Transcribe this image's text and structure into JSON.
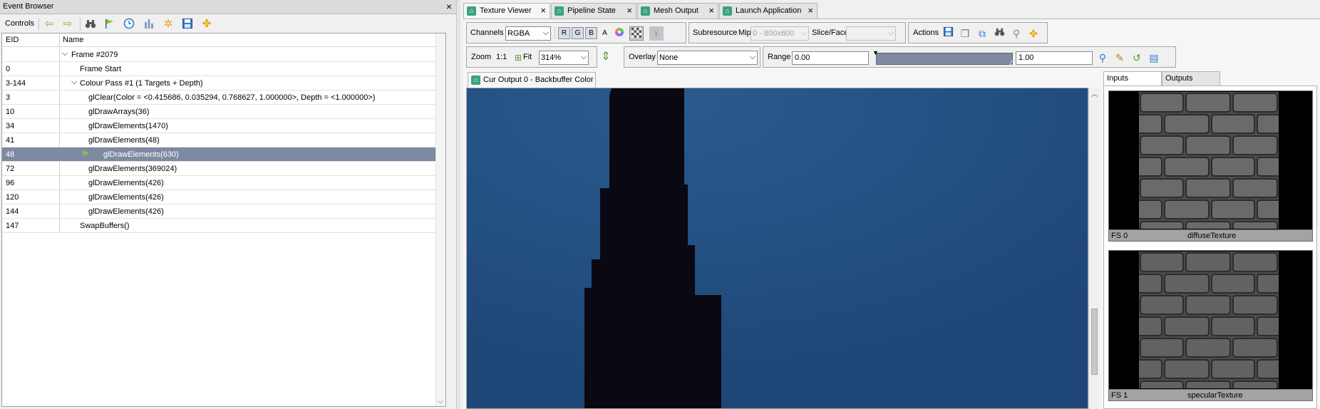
{
  "event_browser": {
    "title": "Event Browser",
    "close": "×",
    "toolbar": {
      "label": "Controls",
      "icons": [
        "arrow-left-icon",
        "arrow-right-icon",
        "binoculars-icon",
        "flag-icon",
        "clock-icon",
        "bar-chart-icon",
        "gear-icon",
        "save-icon",
        "puzzle-icon"
      ]
    },
    "columns": {
      "eid": "EID",
      "name": "Name"
    },
    "rows": [
      {
        "eid": "",
        "name": "Frame #2079",
        "expanded": true
      },
      {
        "eid": "0",
        "name": "Frame Start"
      },
      {
        "eid": "3-144",
        "name": "Colour Pass #1 (1 Targets + Depth)",
        "expanded": true
      },
      {
        "eid": "3",
        "name": "glClear(Color = <0.415686, 0.035294, 0.768627, 1.000000>, Depth = <1.000000>)"
      },
      {
        "eid": "10",
        "name": "glDrawArrays(36)"
      },
      {
        "eid": "34",
        "name": "glDrawElements(1470)"
      },
      {
        "eid": "41",
        "name": "glDrawElements(48)"
      },
      {
        "eid": "48",
        "name": "glDrawElements(630)",
        "selected": true
      },
      {
        "eid": "72",
        "name": "glDrawElements(369024)"
      },
      {
        "eid": "96",
        "name": "glDrawElements(426)"
      },
      {
        "eid": "120",
        "name": "glDrawElements(426)"
      },
      {
        "eid": "144",
        "name": "glDrawElements(426)"
      },
      {
        "eid": "147",
        "name": "SwapBuffers()"
      }
    ]
  },
  "tabs": [
    {
      "label": "Texture Viewer",
      "active": true
    },
    {
      "label": "Pipeline State"
    },
    {
      "label": "Mesh Output"
    },
    {
      "label": "Launch Application"
    }
  ],
  "toolbar": {
    "channels_label": "Channels",
    "channels_value": "RGBA",
    "r": "R",
    "g": "G",
    "b": "B",
    "a": "A",
    "subresource_label": "Subresource",
    "mip_label": "Mip",
    "mip_value": "0 - 800x600",
    "slice_label": "Slice/Face",
    "slice_value": "",
    "actions_label": "Actions",
    "zoom_label": "Zoom",
    "one_to_one": "1:1",
    "fit_label": "Fit",
    "zoom_value": "314%",
    "overlay_label": "Overlay",
    "overlay_value": "None",
    "range_label": "Range",
    "range_min": "0.00",
    "range_max": "1.00"
  },
  "view": {
    "tab_label": "Cur Output 0 - Backbuffer Color",
    "background_color": "#234c7a"
  },
  "thumbnails": {
    "tabs": [
      {
        "label": "Inputs",
        "active": true
      },
      {
        "label": "Outputs"
      }
    ],
    "items": [
      {
        "slot": "FS 0",
        "name": "diffuseTexture"
      },
      {
        "slot": "FS 1",
        "name": "specularTexture"
      }
    ]
  },
  "colors": {
    "selection": "#7e8aa2",
    "tab_icon": "#3aa37a",
    "flag": "#8cc63f"
  }
}
